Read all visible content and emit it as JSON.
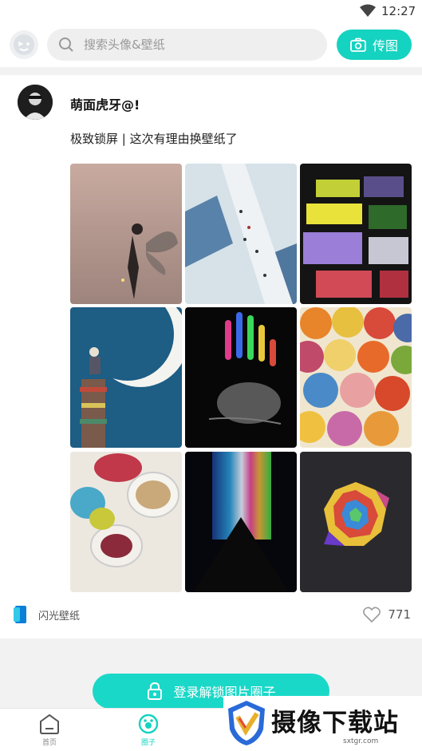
{
  "status_bar": {
    "time": "12:27"
  },
  "header": {
    "search_placeholder": "搜索头像&壁纸",
    "upload_label": "传图"
  },
  "post": {
    "username": "萌面虎牙@!",
    "caption": "极致锁屏 | 这次有理由换壁纸了",
    "images": [
      {
        "name": "fairy-girl-wallpaper"
      },
      {
        "name": "bridge-crowd-wallpaper"
      },
      {
        "name": "colored-glass-wallpaper"
      },
      {
        "name": "moon-books-wallpaper"
      },
      {
        "name": "neon-hand-wallpaper"
      },
      {
        "name": "cat-pattern-wallpaper"
      },
      {
        "name": "coffee-cups-wallpaper"
      },
      {
        "name": "prism-light-wallpaper"
      },
      {
        "name": "geometric-mandala-wallpaper"
      }
    ],
    "source_label": "闪光壁纸",
    "like_count": "771"
  },
  "login_button": {
    "label": "登录解锁图片圈子"
  },
  "bottom_nav": {
    "items": [
      {
        "label": "首页"
      },
      {
        "label": "圈子"
      }
    ]
  },
  "watermark": {
    "text": "摄像下载站",
    "url": "sxtgr.com"
  },
  "colors": {
    "accent": "#14d3c0",
    "background": "#ffffff",
    "band": "#f2f2f2"
  }
}
